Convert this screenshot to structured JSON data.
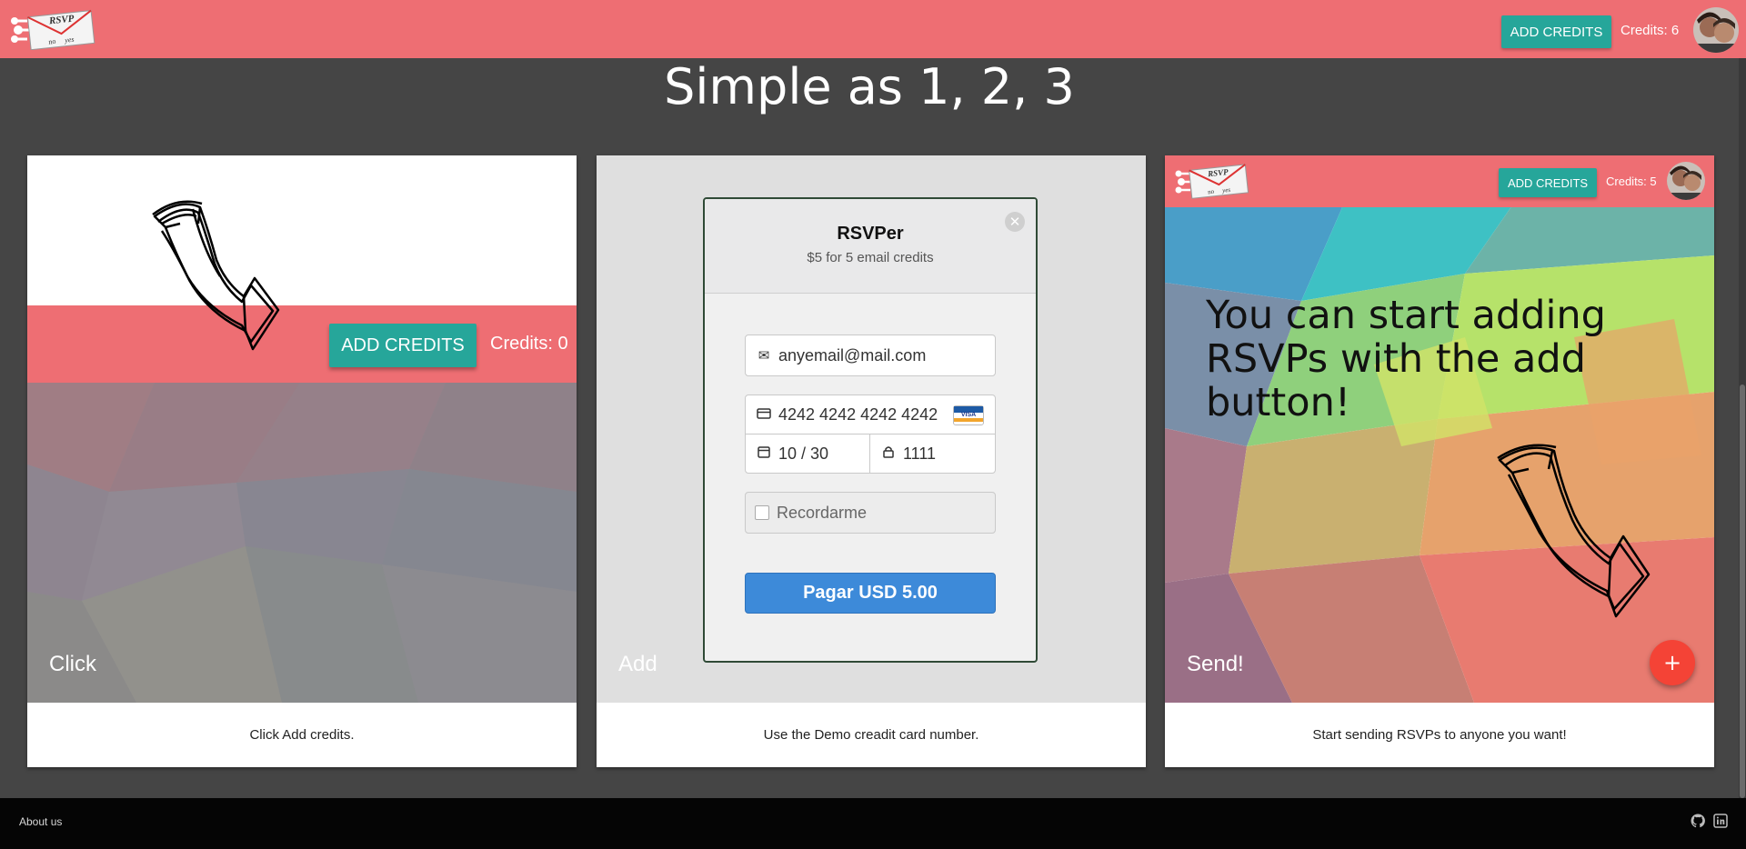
{
  "navbar": {
    "logo_text": "RSVP",
    "logo_words": [
      "no",
      "yes"
    ],
    "add_credits_label": "ADD CREDITS",
    "credits_label": "Credits: 6"
  },
  "headline": "Simple as 1, 2, 3",
  "cards": [
    {
      "title": "Click",
      "description": "Click Add credits.",
      "demo": {
        "add_credits_label": "ADD CREDITS",
        "credits_label": "Credits: 0"
      }
    },
    {
      "title": "Add",
      "description": "Use the Demo creadit card number.",
      "payment_modal": {
        "title": "RSVPer",
        "subtitle": "$5 for 5 email credits",
        "email": "anyemail@mail.com",
        "card_number": "4242 4242 4242 4242",
        "card_brand": "VISA",
        "expiry": "10 / 30",
        "cvc": "1111",
        "remember_label": "Recordarme",
        "pay_label": "Pagar USD 5.00"
      }
    },
    {
      "title": "Send!",
      "description": "Start sending RSVPs to anyone you want!",
      "demo": {
        "add_credits_label": "ADD CREDITS",
        "credits_label": "Credits: 5",
        "message": "You can start adding RSVPs with the add button!",
        "fab_label": "+"
      }
    }
  ],
  "footer": {
    "about_label": "About us",
    "icons": [
      "github-icon",
      "linkedin-icon"
    ]
  },
  "colors": {
    "primary": "#ee6e73",
    "accent": "#26a69a",
    "background": "#454545",
    "fab": "#f44336",
    "pay_button": "#3d8ad9"
  }
}
